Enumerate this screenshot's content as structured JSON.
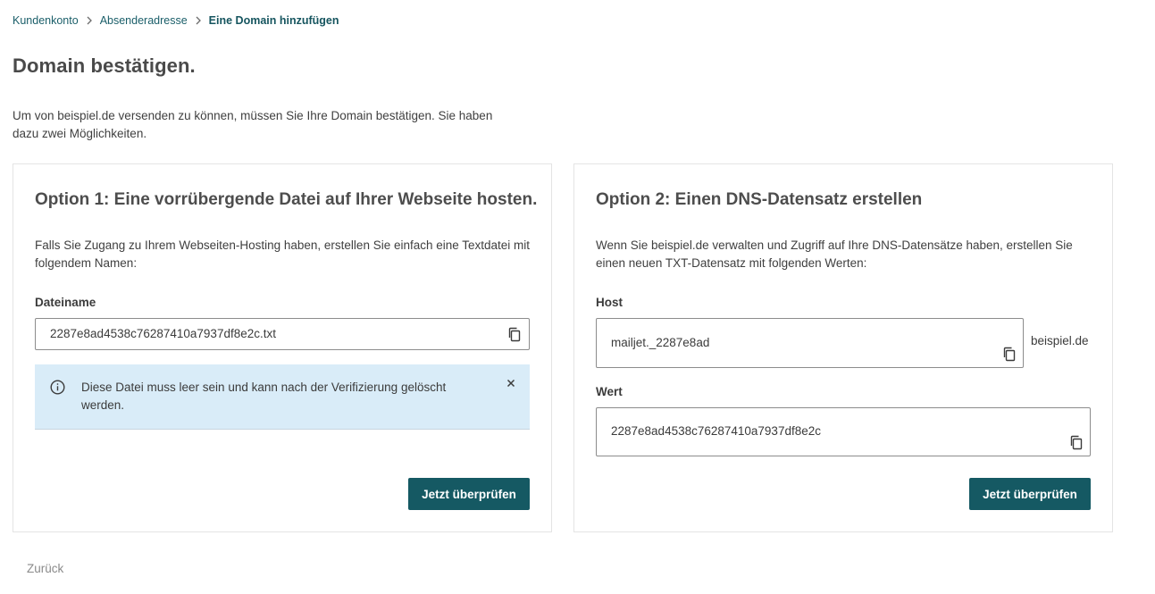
{
  "breadcrumb": {
    "items": [
      "Kundenkonto",
      "Absenderadresse"
    ],
    "current": "Eine Domain hinzufügen"
  },
  "page_title": "Domain bestätigen.",
  "intro": "Um von beispiel.de versenden zu können, müssen Sie Ihre Domain bestätigen. Sie haben dazu zwei Möglichkeiten.",
  "option1": {
    "title": "Option 1: Eine vorrübergende Datei auf Ihrer Webseite hosten.",
    "description": "Falls Sie Zugang zu Ihrem Webseiten-Hosting haben, erstellen Sie einfach eine Textdatei mit folgendem Namen:",
    "filename_label": "Dateiname",
    "filename_value": "2287e8ad4538c76287410a7937df8e2c.txt",
    "info_text": "Diese Datei muss leer sein und kann nach der Verifizierung gelöscht werden.",
    "verify_label": "Jetzt überprüfen"
  },
  "option2": {
    "title": "Option 2: Einen DNS-Datensatz erstellen",
    "description": "Wenn Sie beispiel.de verwalten und Zugriff auf Ihre DNS-Datensätze haben, erstellen Sie einen neuen TXT-Datensatz mit folgenden Werten:",
    "host_label": "Host",
    "host_value": "mailjet._2287e8ad",
    "host_suffix": "beispiel.de",
    "value_label": "Wert",
    "value_value": "2287e8ad4538c76287410a7937df8e2c",
    "verify_label": "Jetzt überprüfen"
  },
  "back_label": "Zurück",
  "icons": {
    "chevron": "chevron-right-icon",
    "copy": "copy-icon",
    "info": "info-icon",
    "close": "close-icon"
  },
  "colors": {
    "accent": "#155963",
    "link": "#1a5e69",
    "info_bg": "#d9ecf8"
  }
}
